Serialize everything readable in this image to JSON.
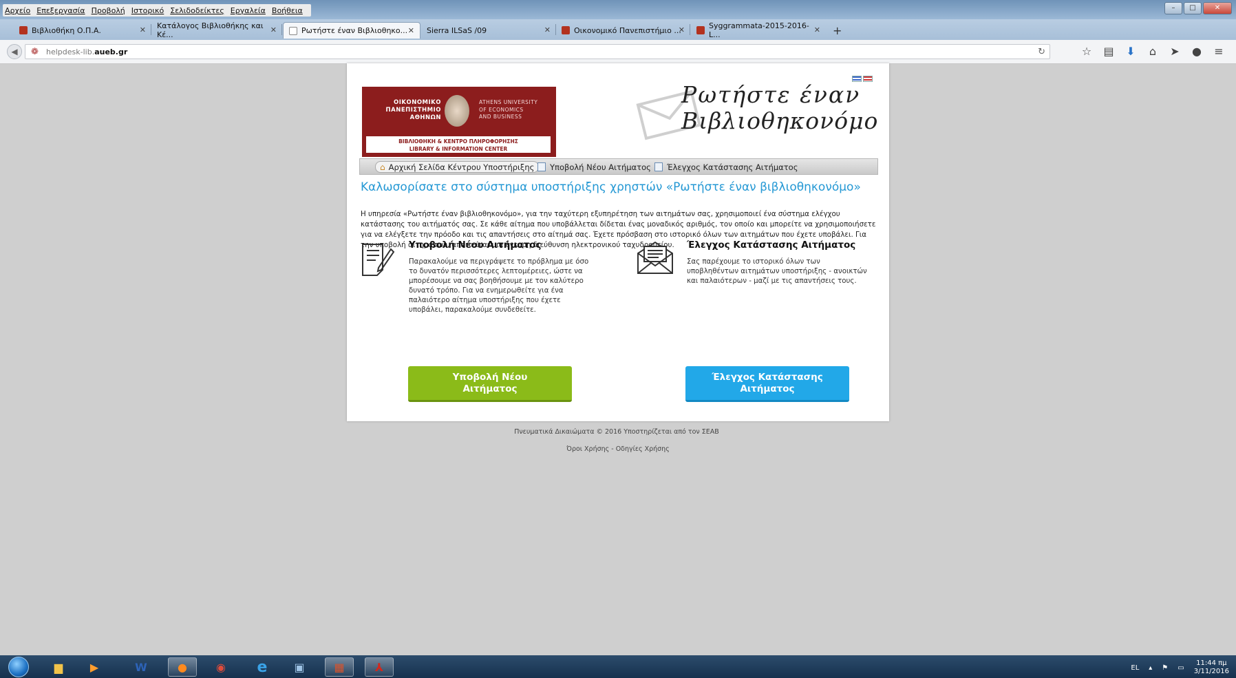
{
  "menubar": {
    "items": [
      "Αρχείο",
      "Επεξεργασία",
      "Προβολή",
      "Ιστορικό",
      "Σελιδοδείκτες",
      "Εργαλεία",
      "Βοήθεια"
    ]
  },
  "tabs": [
    {
      "label": "Βιβλιοθήκη Ο.Π.Α."
    },
    {
      "label": "Κατάλογος Βιβλιοθήκης και Κέ..."
    },
    {
      "label": "Ρωτήστε έναν Βιβλιοθηκο..."
    },
    {
      "label": "Sierra ILSaS /09"
    },
    {
      "label": "Οικονομικό Πανεπιστήμιο ..."
    },
    {
      "label": "Syggrammata-2015-2016-L..."
    }
  ],
  "address": {
    "prefix": "helpdesk-lib.",
    "domain": "aueb.gr"
  },
  "header": {
    "logo": {
      "greek_line1": "ΟΙΚΟΝΟΜΙΚΟ",
      "greek_line2": "ΠΑΝΕΠΙΣΤΗΜΙΟ",
      "greek_line3": "ΑΘΗΝΩΝ",
      "eng_line1": "ATHENS UNIVERSITY",
      "eng_line2": "OF ECONOMICS",
      "eng_line3": "AND BUSINESS",
      "band_line1": "ΒΙΒΛΙΟΘΗΚΗ & ΚΕΝΤΡΟ ΠΛΗΡΟΦΟΡΗΣΗΣ",
      "band_line2": "LIBRARY & INFORMATION CENTER"
    },
    "title_line1": "Ρωτήστε έναν",
    "title_line2": "Βιβλιοθηκονόμο"
  },
  "nav": {
    "home": "Αρχική Σελίδα Κέντρου Υποστήριξης",
    "submit": "Υποβολή Νέου Αιτήματος",
    "status": "Έλεγχος Κατάστασης Αιτήματος"
  },
  "main": {
    "welcome": "Καλωσορίσατε στο σύστημα υποστήριξης χρηστών «Ρωτήστε έναν βιβλιοθηκονόμο»",
    "intro": "Η υπηρεσία «Ρωτήστε έναν βιβλιοθηκονόμο», για την ταχύτερη εξυπηρέτηση των αιτημάτων σας, χρησιμοποιεί ένα σύστημα ελέγχου κατάστασης του αιτήματός σας. Σε κάθε αίτημα που υποβάλλεται δίδεται ένας μοναδικός αριθμός, τον οποίο και μπορείτε να χρησιμοποιήσετε για να ελέγξετε την πρόοδο και τις απαντήσεις στο αίτημά σας. Έχετε πρόσβαση στο ιστορικό όλων των αιτημάτων που έχετε υποβάλει. Για την υποβολή αιτημάτων, απαιτείται μια έγκυρη διεύθυνση ηλεκτρονικού ταχυδρομείου.",
    "submit_heading": "Υποβολή Νέου Αιτήματος",
    "submit_text": "Παρακαλούμε να περιγράψετε το πρόβλημα με όσο το δυνατόν περισσότερες λεπτομέρειες, ώστε να μπορέσουμε να σας βοηθήσουμε με τον καλύτερο δυνατό τρόπο. Για να ενημερωθείτε για ένα παλαιότερο αίτημα υποστήριξης που έχετε υποβάλει, παρακαλούμε συνδεθείτε.",
    "status_heading": "Έλεγχος Κατάστασης Αιτήματος",
    "status_text": "Σας παρέχουμε το ιστορικό όλων των υποβληθέντων αιτημάτων υποστήριξης - ανοικτών και παλαιότερων - μαζί με τις απαντήσεις τους.",
    "submit_button_line1": "Υποβολή Νέου",
    "submit_button_line2": "Αιτήματος",
    "status_button_line1": "Έλεγχος Κατάστασης",
    "status_button_line2": "Αιτήματος"
  },
  "footer": {
    "copyright": "Πνευματικά Δικαιώματα © 2016 Υποστηρίζεται από τον ΣΕΑΒ",
    "links": "Όροι Χρήσης - Οδηγίες Χρήσης"
  },
  "taskbar": {
    "lang": "EL",
    "time": "11:44 πμ",
    "date": "3/11/2016"
  },
  "colors": {
    "accent_blue": "#2498d4",
    "submit_green": "#8bbb19",
    "status_blue": "#22a8e8",
    "logo_red": "#8c1d1d"
  }
}
